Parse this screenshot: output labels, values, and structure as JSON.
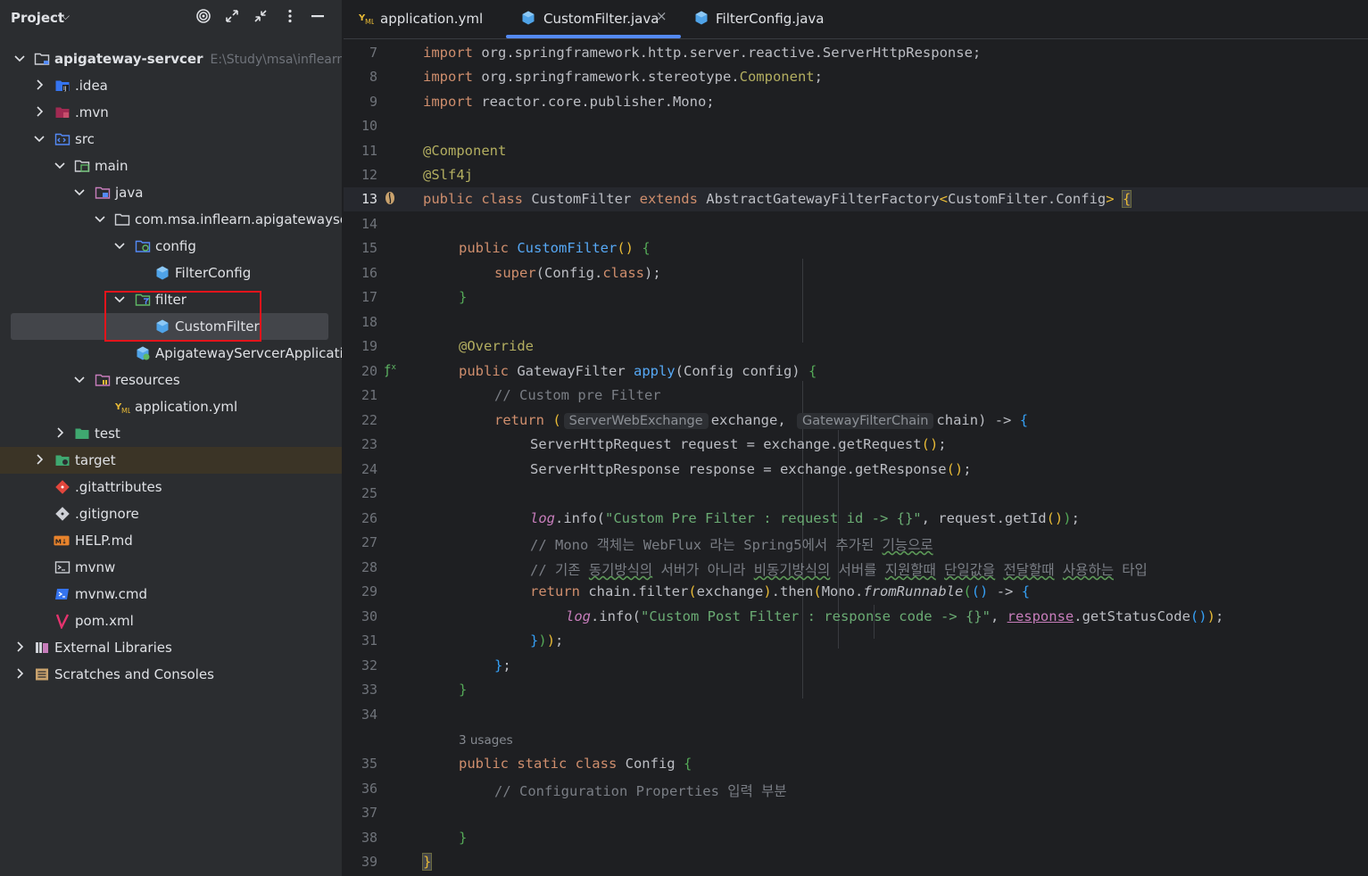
{
  "project_panel": {
    "title": "Project",
    "tree": [
      {
        "label": "apigateway-servcer",
        "hint": "E:\\Study\\msa\\inflearn\\a",
        "icon": "module-folder-icon",
        "expanded": true,
        "bold": true
      },
      {
        "label": ".idea",
        "icon": "idea-folder-icon",
        "expanded": false
      },
      {
        "label": ".mvn",
        "icon": "mvn-folder-icon",
        "expanded": false
      },
      {
        "label": "src",
        "icon": "source-root-folder-icon",
        "expanded": true
      },
      {
        "label": "main",
        "icon": "folder-icon",
        "expanded": true
      },
      {
        "label": "java",
        "icon": "java-source-folder-icon",
        "expanded": true
      },
      {
        "label": "com.msa.inflearn.apigatewayservce",
        "icon": "package-icon",
        "expanded": true
      },
      {
        "label": "config",
        "icon": "package-icon",
        "expanded": true
      },
      {
        "label": "FilterConfig",
        "icon": "java-class-icon"
      },
      {
        "label": "filter",
        "icon": "package-icon",
        "expanded": true
      },
      {
        "label": "CustomFilter",
        "icon": "java-class-icon",
        "selected": true
      },
      {
        "label": "ApigatewayServcerApplication",
        "icon": "spring-boot-class-icon"
      },
      {
        "label": "resources",
        "icon": "resources-folder-icon",
        "expanded": true
      },
      {
        "label": "application.yml",
        "icon": "yaml-file-icon"
      },
      {
        "label": "test",
        "icon": "test-folder-icon",
        "expanded": false
      },
      {
        "label": "target",
        "icon": "excluded-folder-icon",
        "expanded": false
      },
      {
        "label": ".gitattributes",
        "icon": "git-file-icon"
      },
      {
        "label": ".gitignore",
        "icon": "gitignore-file-icon"
      },
      {
        "label": "HELP.md",
        "icon": "markdown-file-icon"
      },
      {
        "label": "mvnw",
        "icon": "shell-script-icon"
      },
      {
        "label": "mvnw.cmd",
        "icon": "cmd-script-icon"
      },
      {
        "label": "pom.xml",
        "icon": "maven-pom-icon"
      },
      {
        "label": "External Libraries",
        "icon": "libraries-icon",
        "expanded": false
      },
      {
        "label": "Scratches and Consoles",
        "icon": "scratches-icon",
        "expanded": false
      }
    ]
  },
  "tabs": [
    {
      "label": "application.yml",
      "icon": "yaml-file-icon"
    },
    {
      "label": "CustomFilter.java",
      "icon": "java-class-icon",
      "active": true,
      "close": "×"
    },
    {
      "label": "FilterConfig.java",
      "icon": "java-class-icon"
    }
  ],
  "editor": {
    "usages_hint": "3 usages",
    "hint_exchange": "ServerWebExchange",
    "hint_chain": "GatewayFilterChain",
    "line_numbers": [
      "7",
      "8",
      "9",
      "10",
      "11",
      "12",
      "13",
      "14",
      "15",
      "16",
      "17",
      "18",
      "19",
      "20",
      "21",
      "22",
      "23",
      "24",
      "25",
      "26",
      "27",
      "28",
      "29",
      "30",
      "31",
      "32",
      "33",
      "34",
      "35",
      "36",
      "37",
      "38",
      "39"
    ],
    "current_line": "13",
    "code": {
      "l7": [
        "import",
        " org.springframework.http.server.reactive.ServerHttpResponse;"
      ],
      "l8": [
        "import",
        " org.springframework.stereotype.",
        "Component",
        ";"
      ],
      "l9": [
        "import",
        " reactor.core.publisher.Mono;"
      ],
      "l11": "@Component",
      "l12": "@Slf4j",
      "l13": [
        "public class",
        " CustomFilter ",
        "extends",
        " AbstractGatewayFilterFactory",
        "<",
        "CustomFilter.Config",
        ">",
        " ",
        "{"
      ],
      "l15": [
        "public",
        " ",
        "CustomFilter",
        "()",
        " ",
        "{"
      ],
      "l16": [
        "super",
        "(Config.",
        "class",
        ");"
      ],
      "l17": "}",
      "l19": "@Override",
      "l20": [
        "public",
        " GatewayFilter ",
        "apply",
        "(Config config) ",
        "{"
      ],
      "l21": "// Custom pre Filter",
      "l22": [
        "return",
        " (",
        "exchange, ",
        "chain) -> ",
        "{"
      ],
      "l23": [
        "ServerHttpRequest request = exchange.getRequest",
        "()",
        ";"
      ],
      "l24": [
        "ServerHttpResponse response = exchange.getResponse",
        "()",
        ";"
      ],
      "l26": [
        "log",
        ".info(",
        "\"Custom Pre Filter : request id -> {}\"",
        ", request.getId",
        "()",
        ")",
        ";"
      ],
      "l27": [
        "// Mono 객체는 WebFlux 라는 Spring5에서 추가된 ",
        "기능으로"
      ],
      "l28": [
        "// 기존 ",
        "동기방식의",
        " 서버가 아니라 ",
        "비동기방식의",
        " 서버를 ",
        "지원할때",
        " ",
        "단일값을",
        " ",
        "전달할때",
        " ",
        "사용하는",
        " 타입"
      ],
      "l29": [
        "return",
        " chain.filter",
        "(",
        "exchange",
        ")",
        ".then",
        "(",
        "Mono.",
        "fromRunnable",
        "(",
        "()",
        " -> ",
        "{"
      ],
      "l30": [
        "log",
        ".info(",
        "\"Custom Post Filter : response code -> {}\"",
        ", ",
        "response",
        ".getStatusCode",
        "()",
        ")",
        ";"
      ],
      "l31": [
        "}",
        ")",
        ")",
        ";"
      ],
      "l32": [
        "}",
        ";"
      ],
      "l33": "}",
      "l35": [
        "public static class",
        " Config ",
        "{"
      ],
      "l36": "// Configuration Properties 입력 부분",
      "l38": "}",
      "l39": "}"
    }
  }
}
